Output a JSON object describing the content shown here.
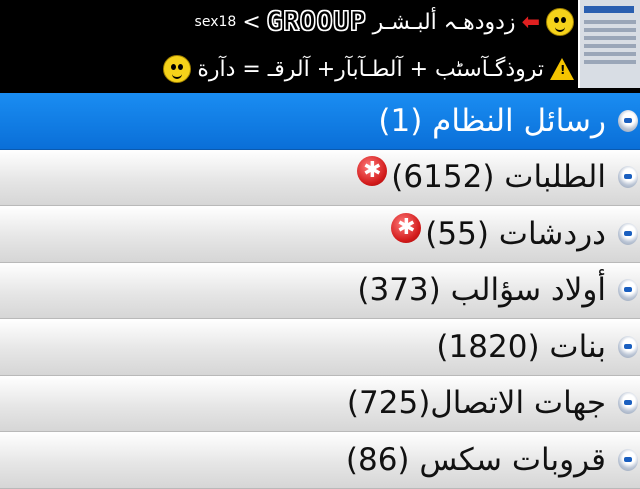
{
  "header": {
    "line1": {
      "tag": "sex18",
      "group": "GROOUP",
      "arabic": "زدودهـہ ألبـشـر"
    },
    "line2": {
      "warning_symbol": "!",
      "arabic": "تروذگـآسٹب + آلطـآبآر+ آلرقـ = دآرة"
    }
  },
  "list": {
    "items": [
      {
        "label": "رسائل النظام (1)",
        "selected": true,
        "badge": false
      },
      {
        "label": "الطلبات (6152)",
        "selected": false,
        "badge": true
      },
      {
        "label": "دردشات (55)",
        "selected": false,
        "badge": true
      },
      {
        "label": "أولاد سؤالب (373)",
        "selected": false,
        "badge": false
      },
      {
        "label": "بنات (1820)",
        "selected": false,
        "badge": false
      },
      {
        "label": "جهات الاتصال(725)",
        "selected": false,
        "badge": false
      },
      {
        "label": "قروبات سكس (86)",
        "selected": false,
        "badge": false
      }
    ],
    "badge_symbol": "✱"
  },
  "colors": {
    "selected": "#0a7ae0",
    "badge": "#d21a1a"
  }
}
